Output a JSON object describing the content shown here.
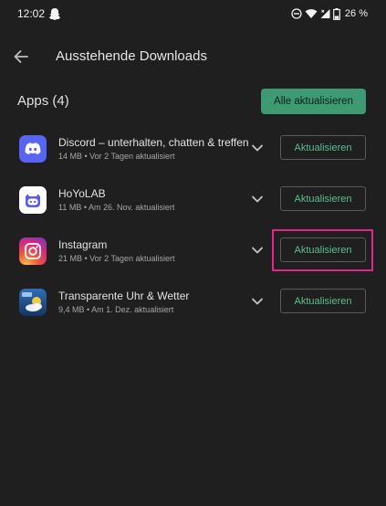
{
  "statusbar": {
    "time": "12:02",
    "battery_percent": "26 %",
    "icons": [
      "snapchat-ghost-icon",
      "do-not-disturb-icon",
      "wifi-icon",
      "signal-icon",
      "battery-icon"
    ]
  },
  "header": {
    "title": "Ausstehende Downloads",
    "back_icon": "arrow-left-icon"
  },
  "section": {
    "title": "Apps (4)",
    "update_all_label": "Alle aktualisieren"
  },
  "apps": [
    {
      "name": "Discord – unterhalten, chatten & treffen",
      "meta": "14 MB  •  Vor 2 Tagen aktualisiert",
      "icon": "discord-icon",
      "button_label": "Aktualisieren"
    },
    {
      "name": "HoYoLAB",
      "meta": "11 MB  •  Am 26. Nov. aktualisiert",
      "icon": "hoyolab-icon",
      "button_label": "Aktualisieren"
    },
    {
      "name": "Instagram",
      "meta": "21 MB  •  Vor 2 Tagen aktualisiert",
      "icon": "instagram-icon",
      "button_label": "Aktualisieren"
    },
    {
      "name": "Transparente Uhr & Wetter",
      "meta": "9,4 MB  •  Am 1. Dez. aktualisiert",
      "icon": "weather-clock-icon",
      "button_label": "Aktualisieren"
    }
  ],
  "colors": {
    "background": "#1f1f1f",
    "accent_green": "#3d9a73",
    "button_text_green": "#58c08f",
    "highlight_pink": "#e0288c"
  }
}
